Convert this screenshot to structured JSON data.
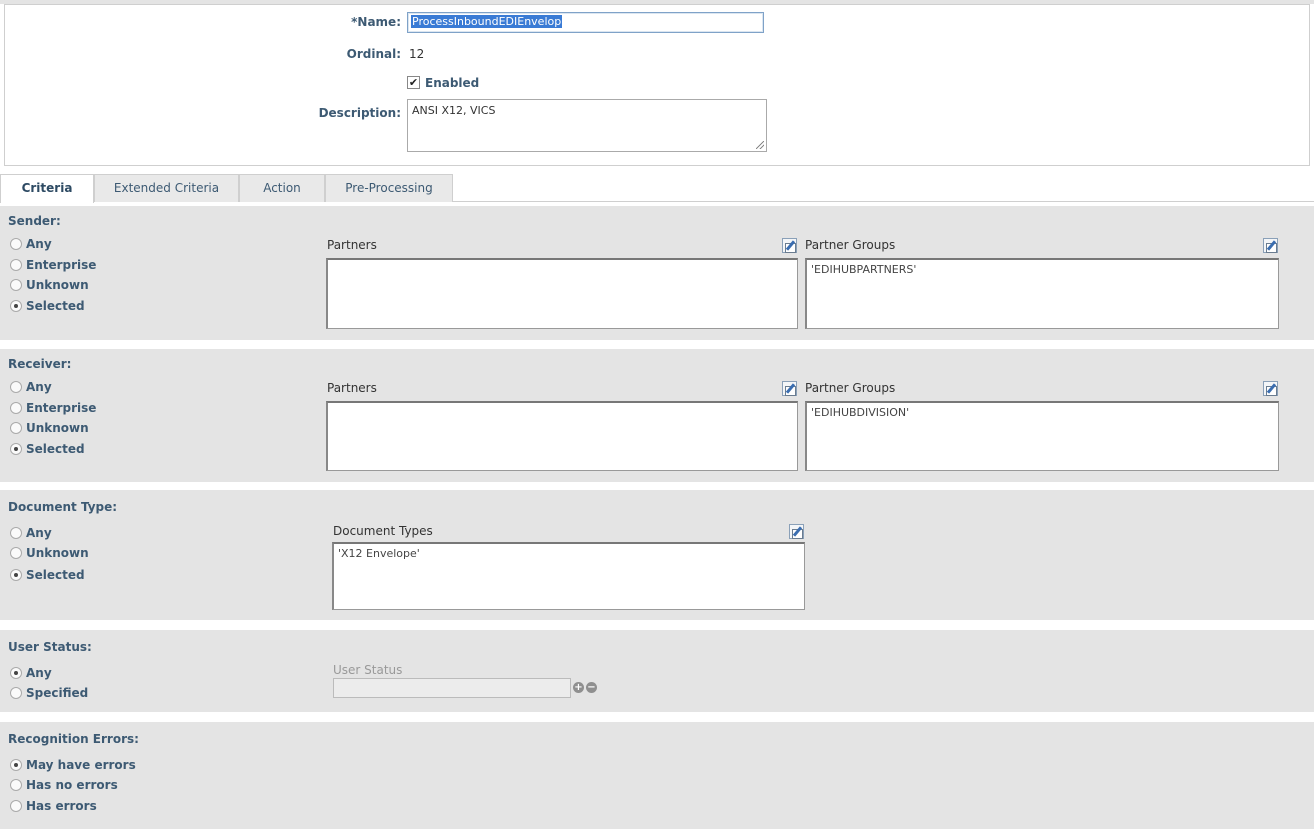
{
  "header": {
    "name_label": "*Name:",
    "name_value": "ProcessInboundEDIEnvelop",
    "ordinal_label": "Ordinal:",
    "ordinal_value": "12",
    "enabled_label": "Enabled",
    "enabled_checked": true,
    "description_label": "Description:",
    "description_value": "ANSI X12, VICS"
  },
  "tabs": [
    {
      "label": "Criteria",
      "active": true
    },
    {
      "label": "Extended Criteria",
      "active": false
    },
    {
      "label": "Action",
      "active": false
    },
    {
      "label": "Pre-Processing",
      "active": false
    }
  ],
  "sender": {
    "title": "Sender:",
    "options": [
      "Any",
      "Enterprise",
      "Unknown",
      "Selected"
    ],
    "selected": "Selected",
    "partners_label": "Partners",
    "partners_value": "",
    "groups_label": "Partner Groups",
    "groups_value": "'EDIHUBPARTNERS'"
  },
  "receiver": {
    "title": "Receiver:",
    "options": [
      "Any",
      "Enterprise",
      "Unknown",
      "Selected"
    ],
    "selected": "Selected",
    "partners_label": "Partners",
    "partners_value": "",
    "groups_label": "Partner Groups",
    "groups_value": "'EDIHUBDIVISION'"
  },
  "document_type": {
    "title": "Document Type:",
    "options": [
      "Any",
      "Unknown",
      "Selected"
    ],
    "selected": "Selected",
    "types_label": "Document Types",
    "types_value": "'X12 Envelope'"
  },
  "user_status": {
    "title": "User Status:",
    "options": [
      "Any",
      "Specified"
    ],
    "selected": "Any",
    "field_label": "User Status",
    "field_value": ""
  },
  "recognition_errors": {
    "title": "Recognition Errors:",
    "options": [
      "May have errors",
      "Has no errors",
      "Has errors"
    ],
    "selected": "May have errors"
  },
  "icons": {
    "edit": "edit-icon",
    "add": "plus-circle-icon",
    "remove": "minus-circle-icon"
  }
}
